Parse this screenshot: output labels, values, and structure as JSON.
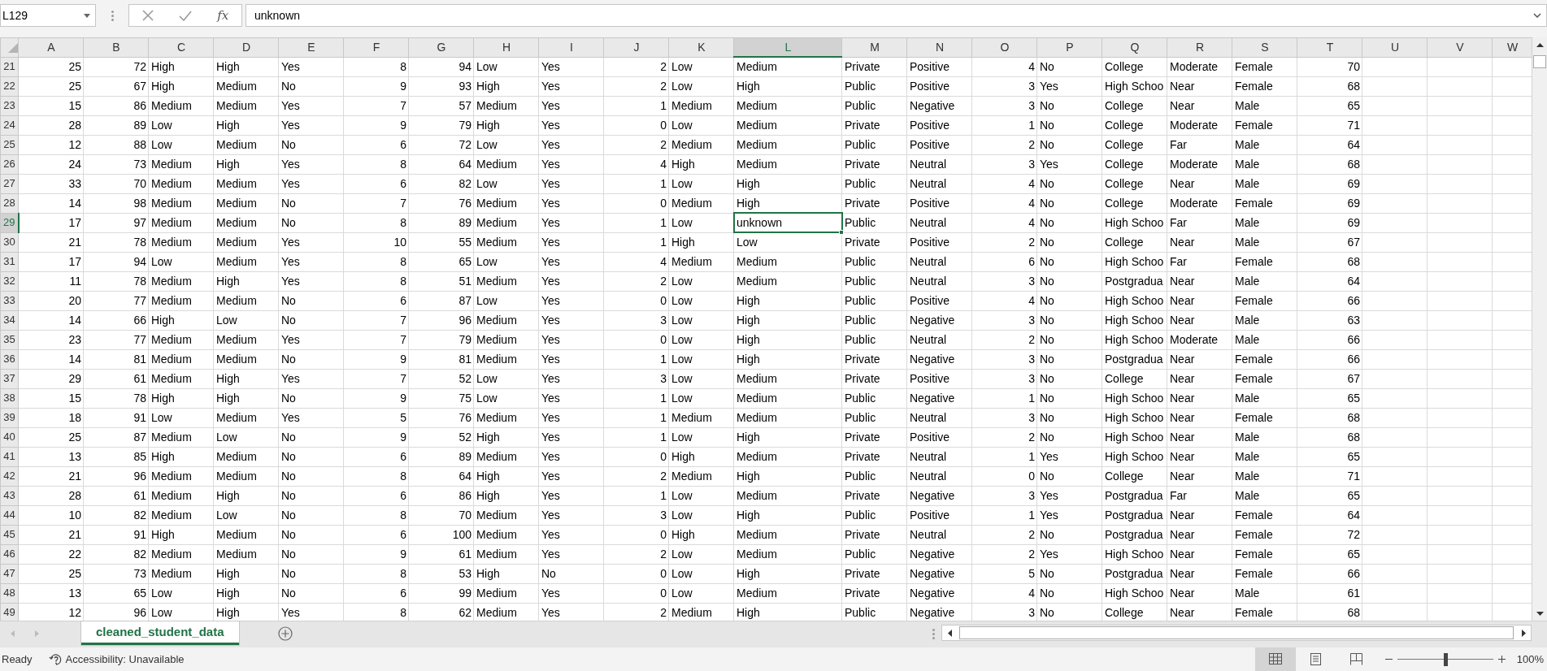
{
  "formula_bar": {
    "name_box": "L129",
    "function_label": "fx",
    "value": "unknown"
  },
  "columns": [
    {
      "label": "A",
      "kind": "number",
      "selected": false
    },
    {
      "label": "B",
      "kind": "number",
      "selected": false
    },
    {
      "label": "C",
      "kind": "text",
      "selected": false
    },
    {
      "label": "D",
      "kind": "text",
      "selected": false
    },
    {
      "label": "E",
      "kind": "text",
      "selected": false
    },
    {
      "label": "F",
      "kind": "number",
      "selected": false
    },
    {
      "label": "G",
      "kind": "number",
      "selected": false
    },
    {
      "label": "H",
      "kind": "text",
      "selected": false
    },
    {
      "label": "I",
      "kind": "text",
      "selected": false
    },
    {
      "label": "J",
      "kind": "number",
      "selected": false
    },
    {
      "label": "K",
      "kind": "text",
      "selected": false
    },
    {
      "label": "L",
      "kind": "text",
      "selected": true
    },
    {
      "label": "M",
      "kind": "text",
      "selected": false
    },
    {
      "label": "N",
      "kind": "text",
      "selected": false
    },
    {
      "label": "O",
      "kind": "number",
      "selected": false
    },
    {
      "label": "P",
      "kind": "text",
      "selected": false
    },
    {
      "label": "Q",
      "kind": "text",
      "selected": false
    },
    {
      "label": "R",
      "kind": "text",
      "selected": false
    },
    {
      "label": "S",
      "kind": "text",
      "selected": false
    },
    {
      "label": "T",
      "kind": "number",
      "selected": false
    },
    {
      "label": "U",
      "kind": "text",
      "selected": false
    },
    {
      "label": "V",
      "kind": "text",
      "selected": false
    },
    {
      "label": "W",
      "kind": "text",
      "selected": false
    }
  ],
  "rows": [
    {
      "label": "21",
      "selected": false,
      "cells": [
        "25",
        "72",
        "High",
        "High",
        "Yes",
        "8",
        "94",
        "Low",
        "Yes",
        "2",
        "Low",
        "Medium",
        "Private",
        "Positive",
        "4",
        "No",
        "College",
        "Moderate",
        "Female",
        "70"
      ]
    },
    {
      "label": "22",
      "selected": false,
      "cells": [
        "25",
        "67",
        "High",
        "Medium",
        "No",
        "9",
        "93",
        "High",
        "Yes",
        "2",
        "Low",
        "High",
        "Public",
        "Positive",
        "3",
        "Yes",
        "High Schoo",
        "Near",
        "Female",
        "68"
      ]
    },
    {
      "label": "23",
      "selected": false,
      "cells": [
        "15",
        "86",
        "Medium",
        "Medium",
        "Yes",
        "7",
        "57",
        "Medium",
        "Yes",
        "1",
        "Medium",
        "Medium",
        "Public",
        "Negative",
        "3",
        "No",
        "College",
        "Near",
        "Male",
        "65"
      ]
    },
    {
      "label": "24",
      "selected": false,
      "cells": [
        "28",
        "89",
        "Low",
        "High",
        "Yes",
        "9",
        "79",
        "High",
        "Yes",
        "0",
        "Low",
        "Medium",
        "Private",
        "Positive",
        "1",
        "No",
        "College",
        "Moderate",
        "Female",
        "71"
      ]
    },
    {
      "label": "25",
      "selected": false,
      "cells": [
        "12",
        "88",
        "Low",
        "Medium",
        "No",
        "6",
        "72",
        "Low",
        "Yes",
        "2",
        "Medium",
        "Medium",
        "Public",
        "Positive",
        "2",
        "No",
        "College",
        "Far",
        "Male",
        "64"
      ]
    },
    {
      "label": "26",
      "selected": false,
      "cells": [
        "24",
        "73",
        "Medium",
        "High",
        "Yes",
        "8",
        "64",
        "Medium",
        "Yes",
        "4",
        "High",
        "Medium",
        "Private",
        "Neutral",
        "3",
        "Yes",
        "College",
        "Moderate",
        "Male",
        "68"
      ]
    },
    {
      "label": "27",
      "selected": false,
      "cells": [
        "33",
        "70",
        "Medium",
        "Medium",
        "Yes",
        "6",
        "82",
        "Low",
        "Yes",
        "1",
        "Low",
        "High",
        "Public",
        "Neutral",
        "4",
        "No",
        "College",
        "Near",
        "Male",
        "69"
      ]
    },
    {
      "label": "28",
      "selected": false,
      "cells": [
        "14",
        "98",
        "Medium",
        "Medium",
        "No",
        "7",
        "76",
        "Medium",
        "Yes",
        "0",
        "Medium",
        "High",
        "Private",
        "Positive",
        "4",
        "No",
        "College",
        "Moderate",
        "Female",
        "69"
      ]
    },
    {
      "label": "29",
      "selected": true,
      "cells": [
        "17",
        "97",
        "Medium",
        "Medium",
        "No",
        "8",
        "89",
        "Medium",
        "Yes",
        "1",
        "Low",
        "unknown",
        "Public",
        "Neutral",
        "4",
        "No",
        "High Schoo",
        "Far",
        "Male",
        "69"
      ]
    },
    {
      "label": "30",
      "selected": false,
      "cells": [
        "21",
        "78",
        "Medium",
        "Medium",
        "Yes",
        "10",
        "55",
        "Medium",
        "Yes",
        "1",
        "High",
        "Low",
        "Private",
        "Positive",
        "2",
        "No",
        "College",
        "Near",
        "Male",
        "67"
      ]
    },
    {
      "label": "31",
      "selected": false,
      "cells": [
        "17",
        "94",
        "Low",
        "Medium",
        "Yes",
        "8",
        "65",
        "Low",
        "Yes",
        "4",
        "Medium",
        "Medium",
        "Public",
        "Neutral",
        "6",
        "No",
        "High Schoo",
        "Far",
        "Female",
        "68"
      ]
    },
    {
      "label": "32",
      "selected": false,
      "cells": [
        "11",
        "78",
        "Medium",
        "High",
        "Yes",
        "8",
        "51",
        "Medium",
        "Yes",
        "2",
        "Low",
        "Medium",
        "Public",
        "Neutral",
        "3",
        "No",
        "Postgradua",
        "Near",
        "Male",
        "64"
      ]
    },
    {
      "label": "33",
      "selected": false,
      "cells": [
        "20",
        "77",
        "Medium",
        "Medium",
        "No",
        "6",
        "87",
        "Low",
        "Yes",
        "0",
        "Low",
        "High",
        "Public",
        "Positive",
        "4",
        "No",
        "High Schoo",
        "Near",
        "Female",
        "66"
      ]
    },
    {
      "label": "34",
      "selected": false,
      "cells": [
        "14",
        "66",
        "High",
        "Low",
        "No",
        "7",
        "96",
        "Medium",
        "Yes",
        "3",
        "Low",
        "High",
        "Public",
        "Negative",
        "3",
        "No",
        "High Schoo",
        "Near",
        "Male",
        "63"
      ]
    },
    {
      "label": "35",
      "selected": false,
      "cells": [
        "23",
        "77",
        "Medium",
        "Medium",
        "Yes",
        "7",
        "79",
        "Medium",
        "Yes",
        "0",
        "Low",
        "High",
        "Public",
        "Neutral",
        "2",
        "No",
        "High Schoo",
        "Moderate",
        "Male",
        "66"
      ]
    },
    {
      "label": "36",
      "selected": false,
      "cells": [
        "14",
        "81",
        "Medium",
        "Medium",
        "No",
        "9",
        "81",
        "Medium",
        "Yes",
        "1",
        "Low",
        "High",
        "Private",
        "Negative",
        "3",
        "No",
        "Postgradua",
        "Near",
        "Female",
        "66"
      ]
    },
    {
      "label": "37",
      "selected": false,
      "cells": [
        "29",
        "61",
        "Medium",
        "High",
        "Yes",
        "7",
        "52",
        "Low",
        "Yes",
        "3",
        "Low",
        "Medium",
        "Private",
        "Positive",
        "3",
        "No",
        "College",
        "Near",
        "Female",
        "67"
      ]
    },
    {
      "label": "38",
      "selected": false,
      "cells": [
        "15",
        "78",
        "High",
        "High",
        "No",
        "9",
        "75",
        "Low",
        "Yes",
        "1",
        "Low",
        "Medium",
        "Public",
        "Negative",
        "1",
        "No",
        "High Schoo",
        "Near",
        "Male",
        "65"
      ]
    },
    {
      "label": "39",
      "selected": false,
      "cells": [
        "18",
        "91",
        "Low",
        "Medium",
        "Yes",
        "5",
        "76",
        "Medium",
        "Yes",
        "1",
        "Medium",
        "Medium",
        "Public",
        "Neutral",
        "3",
        "No",
        "High Schoo",
        "Near",
        "Female",
        "68"
      ]
    },
    {
      "label": "40",
      "selected": false,
      "cells": [
        "25",
        "87",
        "Medium",
        "Low",
        "No",
        "9",
        "52",
        "High",
        "Yes",
        "1",
        "Low",
        "High",
        "Private",
        "Positive",
        "2",
        "No",
        "High Schoo",
        "Near",
        "Male",
        "68"
      ]
    },
    {
      "label": "41",
      "selected": false,
      "cells": [
        "13",
        "85",
        "High",
        "Medium",
        "No",
        "6",
        "89",
        "Medium",
        "Yes",
        "0",
        "High",
        "Medium",
        "Private",
        "Neutral",
        "1",
        "Yes",
        "High Schoo",
        "Near",
        "Male",
        "65"
      ]
    },
    {
      "label": "42",
      "selected": false,
      "cells": [
        "21",
        "96",
        "Medium",
        "Medium",
        "No",
        "8",
        "64",
        "High",
        "Yes",
        "2",
        "Medium",
        "High",
        "Public",
        "Neutral",
        "0",
        "No",
        "College",
        "Near",
        "Male",
        "71"
      ]
    },
    {
      "label": "43",
      "selected": false,
      "cells": [
        "28",
        "61",
        "Medium",
        "High",
        "No",
        "6",
        "86",
        "High",
        "Yes",
        "1",
        "Low",
        "Medium",
        "Private",
        "Negative",
        "3",
        "Yes",
        "Postgradua",
        "Far",
        "Male",
        "65"
      ]
    },
    {
      "label": "44",
      "selected": false,
      "cells": [
        "10",
        "82",
        "Medium",
        "Low",
        "No",
        "8",
        "70",
        "Medium",
        "Yes",
        "3",
        "Low",
        "High",
        "Public",
        "Positive",
        "1",
        "Yes",
        "Postgradua",
        "Near",
        "Female",
        "64"
      ]
    },
    {
      "label": "45",
      "selected": false,
      "cells": [
        "21",
        "91",
        "High",
        "Medium",
        "No",
        "6",
        "100",
        "Medium",
        "Yes",
        "0",
        "High",
        "Medium",
        "Private",
        "Neutral",
        "2",
        "No",
        "Postgradua",
        "Near",
        "Female",
        "72"
      ]
    },
    {
      "label": "46",
      "selected": false,
      "cells": [
        "22",
        "82",
        "Medium",
        "Medium",
        "No",
        "9",
        "61",
        "Medium",
        "Yes",
        "2",
        "Low",
        "Medium",
        "Public",
        "Negative",
        "2",
        "Yes",
        "High Schoo",
        "Near",
        "Female",
        "65"
      ]
    },
    {
      "label": "47",
      "selected": false,
      "cells": [
        "25",
        "73",
        "Medium",
        "High",
        "No",
        "8",
        "53",
        "High",
        "No",
        "0",
        "Low",
        "High",
        "Private",
        "Negative",
        "5",
        "No",
        "Postgradua",
        "Near",
        "Female",
        "66"
      ]
    },
    {
      "label": "48",
      "selected": false,
      "cells": [
        "13",
        "65",
        "Low",
        "High",
        "No",
        "6",
        "99",
        "Medium",
        "Yes",
        "0",
        "Low",
        "Medium",
        "Private",
        "Negative",
        "4",
        "No",
        "High Schoo",
        "Near",
        "Male",
        "61"
      ]
    },
    {
      "label": "49",
      "selected": false,
      "cells": [
        "12",
        "96",
        "Low",
        "High",
        "Yes",
        "8",
        "62",
        "Medium",
        "Yes",
        "2",
        "Medium",
        "High",
        "Public",
        "Negative",
        "3",
        "No",
        "College",
        "Near",
        "Female",
        "68"
      ]
    }
  ],
  "sheet_tabs": [
    {
      "label": "cleaned_student_data",
      "selected": true
    }
  ],
  "status_bar": {
    "mode": "Ready",
    "accessibility": "Accessibility: Unavailable",
    "views": [
      {
        "kind": "normal",
        "selected": true
      },
      {
        "kind": "page-layout",
        "selected": false
      },
      {
        "kind": "page-break",
        "selected": false
      }
    ],
    "zoom": {
      "level": 0.5,
      "reading": "100%"
    }
  }
}
